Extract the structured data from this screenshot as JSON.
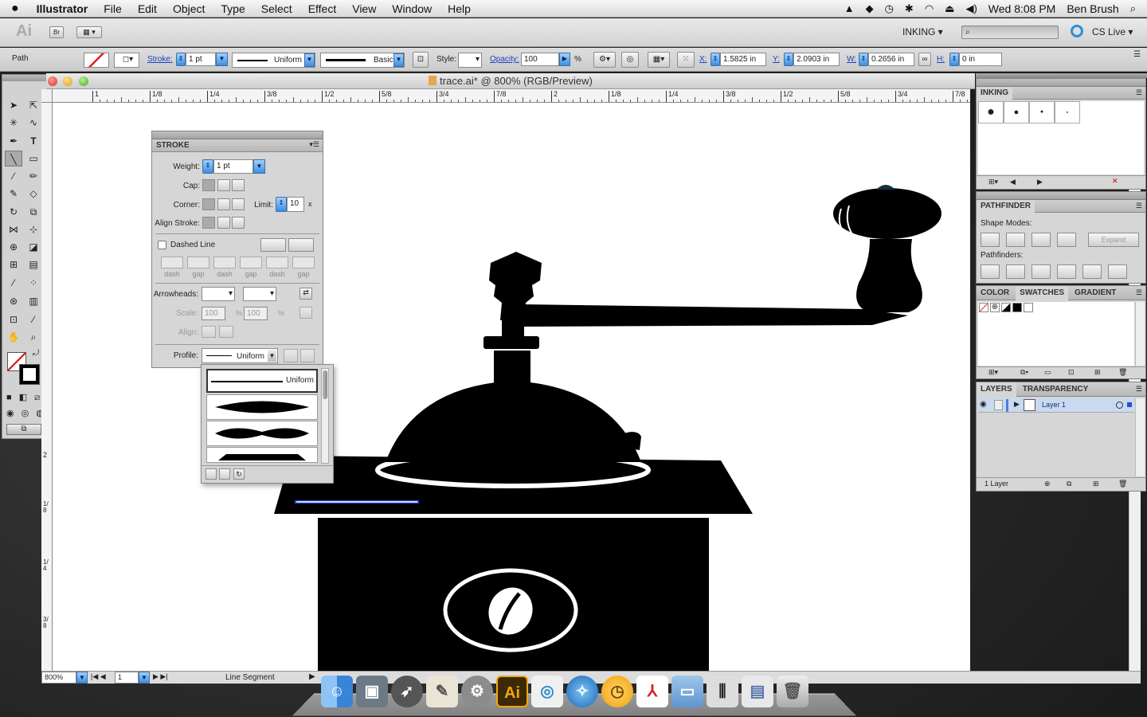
{
  "menubar": {
    "apple": "",
    "app_name": "Illustrator",
    "menus": [
      "File",
      "Edit",
      "Object",
      "Type",
      "Select",
      "Effect",
      "View",
      "Window",
      "Help"
    ],
    "clock": "Wed 8:08 PM",
    "user": "Ben Brush"
  },
  "appbar": {
    "logo": "Ai",
    "bridge": "Br",
    "workspace": "INKING ▾",
    "cslive": "CS Live ▾"
  },
  "control": {
    "selection": "Path",
    "stroke_label": "Stroke:",
    "stroke_value": "1 pt",
    "profile": "Uniform",
    "brush": "Basic",
    "style_label": "Style:",
    "opacity_label": "Opacity:",
    "opacity_value": "100",
    "percent": "%",
    "x_label": "X:",
    "x_value": "1.5825 in",
    "y_label": "Y:",
    "y_value": "2.0903 in",
    "w_label": "W:",
    "w_value": "0.2656 in",
    "h_label": "H:",
    "h_value": "0 in"
  },
  "document": {
    "title": "trace.ai* @ 800% (RGB/Preview)",
    "ruler_labels": [
      "1",
      "1/8",
      "1/4",
      "3/8",
      "1/2",
      "5/8",
      "3/4",
      "7/8",
      "2",
      "1/8",
      "1/4",
      "3/8",
      "1/2",
      "5/8",
      "3/4",
      "7/8"
    ],
    "vruler_labels": [
      "2",
      "1/8",
      "1/4",
      "3/8"
    ]
  },
  "status": {
    "zoom": "800%",
    "artboard": "1",
    "info": "Line Segment"
  },
  "stroke_panel": {
    "title": "STROKE",
    "weight_label": "Weight:",
    "weight_value": "1 pt",
    "cap_label": "Cap:",
    "corner_label": "Corner:",
    "limit_label": "Limit:",
    "limit_value": "10",
    "limit_x": "x",
    "align_label": "Align Stroke:",
    "dashed_label": "Dashed Line",
    "dash_labels": [
      "dash",
      "gap",
      "dash",
      "gap",
      "dash",
      "gap"
    ],
    "arrowheads_label": "Arrowheads:",
    "scale_label": "Scale:",
    "scale_1": "100",
    "scale_2": "100",
    "percent": "%",
    "align2_label": "Align:",
    "profile_label": "Profile:",
    "profile_value": "Uniform",
    "profile_options": [
      "Uniform"
    ]
  },
  "inking_panel": {
    "title": "INKING"
  },
  "pathfinder_panel": {
    "title": "PATHFINDER",
    "shape_modes": "Shape Modes:",
    "expand": "Expand",
    "pathfinders": "Pathfinders:"
  },
  "color_panel": {
    "tabs": [
      "COLOR",
      "SWATCHES",
      "GRADIENT"
    ]
  },
  "layers_panel": {
    "tabs": [
      "LAYERS",
      "TRANSPARENCY"
    ],
    "layer_name": "Layer 1",
    "footer": "1 Layer"
  },
  "dock": {
    "illustrator_label": "Ai"
  },
  "colors": {
    "accent": "#3b8fe3",
    "canvas": "#ffffff",
    "art": "#000000",
    "selection": "#2a4bd7"
  }
}
